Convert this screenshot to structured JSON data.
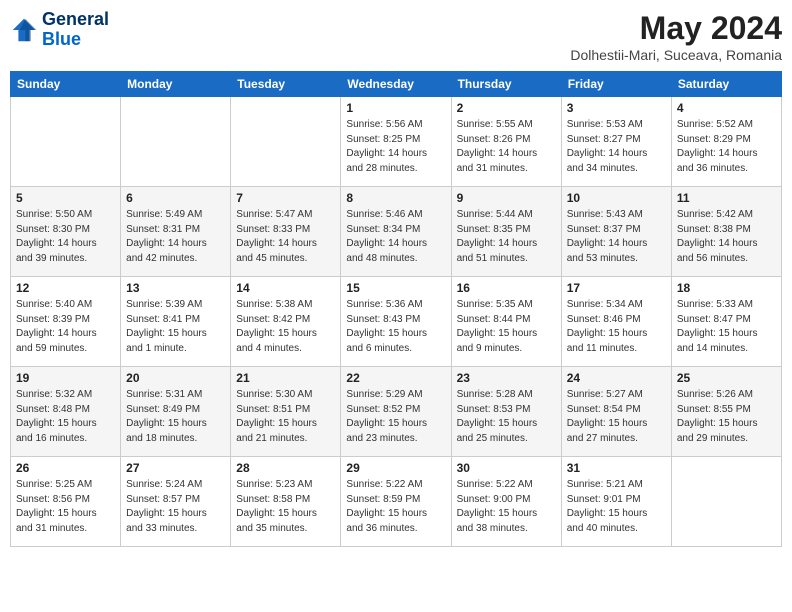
{
  "header": {
    "logo_line1": "General",
    "logo_line2": "Blue",
    "month": "May 2024",
    "location": "Dolhestii-Mari, Suceava, Romania"
  },
  "weekdays": [
    "Sunday",
    "Monday",
    "Tuesday",
    "Wednesday",
    "Thursday",
    "Friday",
    "Saturday"
  ],
  "weeks": [
    [
      {
        "day": "",
        "info": ""
      },
      {
        "day": "",
        "info": ""
      },
      {
        "day": "",
        "info": ""
      },
      {
        "day": "1",
        "info": "Sunrise: 5:56 AM\nSunset: 8:25 PM\nDaylight: 14 hours\nand 28 minutes."
      },
      {
        "day": "2",
        "info": "Sunrise: 5:55 AM\nSunset: 8:26 PM\nDaylight: 14 hours\nand 31 minutes."
      },
      {
        "day": "3",
        "info": "Sunrise: 5:53 AM\nSunset: 8:27 PM\nDaylight: 14 hours\nand 34 minutes."
      },
      {
        "day": "4",
        "info": "Sunrise: 5:52 AM\nSunset: 8:29 PM\nDaylight: 14 hours\nand 36 minutes."
      }
    ],
    [
      {
        "day": "5",
        "info": "Sunrise: 5:50 AM\nSunset: 8:30 PM\nDaylight: 14 hours\nand 39 minutes."
      },
      {
        "day": "6",
        "info": "Sunrise: 5:49 AM\nSunset: 8:31 PM\nDaylight: 14 hours\nand 42 minutes."
      },
      {
        "day": "7",
        "info": "Sunrise: 5:47 AM\nSunset: 8:33 PM\nDaylight: 14 hours\nand 45 minutes."
      },
      {
        "day": "8",
        "info": "Sunrise: 5:46 AM\nSunset: 8:34 PM\nDaylight: 14 hours\nand 48 minutes."
      },
      {
        "day": "9",
        "info": "Sunrise: 5:44 AM\nSunset: 8:35 PM\nDaylight: 14 hours\nand 51 minutes."
      },
      {
        "day": "10",
        "info": "Sunrise: 5:43 AM\nSunset: 8:37 PM\nDaylight: 14 hours\nand 53 minutes."
      },
      {
        "day": "11",
        "info": "Sunrise: 5:42 AM\nSunset: 8:38 PM\nDaylight: 14 hours\nand 56 minutes."
      }
    ],
    [
      {
        "day": "12",
        "info": "Sunrise: 5:40 AM\nSunset: 8:39 PM\nDaylight: 14 hours\nand 59 minutes."
      },
      {
        "day": "13",
        "info": "Sunrise: 5:39 AM\nSunset: 8:41 PM\nDaylight: 15 hours\nand 1 minute."
      },
      {
        "day": "14",
        "info": "Sunrise: 5:38 AM\nSunset: 8:42 PM\nDaylight: 15 hours\nand 4 minutes."
      },
      {
        "day": "15",
        "info": "Sunrise: 5:36 AM\nSunset: 8:43 PM\nDaylight: 15 hours\nand 6 minutes."
      },
      {
        "day": "16",
        "info": "Sunrise: 5:35 AM\nSunset: 8:44 PM\nDaylight: 15 hours\nand 9 minutes."
      },
      {
        "day": "17",
        "info": "Sunrise: 5:34 AM\nSunset: 8:46 PM\nDaylight: 15 hours\nand 11 minutes."
      },
      {
        "day": "18",
        "info": "Sunrise: 5:33 AM\nSunset: 8:47 PM\nDaylight: 15 hours\nand 14 minutes."
      }
    ],
    [
      {
        "day": "19",
        "info": "Sunrise: 5:32 AM\nSunset: 8:48 PM\nDaylight: 15 hours\nand 16 minutes."
      },
      {
        "day": "20",
        "info": "Sunrise: 5:31 AM\nSunset: 8:49 PM\nDaylight: 15 hours\nand 18 minutes."
      },
      {
        "day": "21",
        "info": "Sunrise: 5:30 AM\nSunset: 8:51 PM\nDaylight: 15 hours\nand 21 minutes."
      },
      {
        "day": "22",
        "info": "Sunrise: 5:29 AM\nSunset: 8:52 PM\nDaylight: 15 hours\nand 23 minutes."
      },
      {
        "day": "23",
        "info": "Sunrise: 5:28 AM\nSunset: 8:53 PM\nDaylight: 15 hours\nand 25 minutes."
      },
      {
        "day": "24",
        "info": "Sunrise: 5:27 AM\nSunset: 8:54 PM\nDaylight: 15 hours\nand 27 minutes."
      },
      {
        "day": "25",
        "info": "Sunrise: 5:26 AM\nSunset: 8:55 PM\nDaylight: 15 hours\nand 29 minutes."
      }
    ],
    [
      {
        "day": "26",
        "info": "Sunrise: 5:25 AM\nSunset: 8:56 PM\nDaylight: 15 hours\nand 31 minutes."
      },
      {
        "day": "27",
        "info": "Sunrise: 5:24 AM\nSunset: 8:57 PM\nDaylight: 15 hours\nand 33 minutes."
      },
      {
        "day": "28",
        "info": "Sunrise: 5:23 AM\nSunset: 8:58 PM\nDaylight: 15 hours\nand 35 minutes."
      },
      {
        "day": "29",
        "info": "Sunrise: 5:22 AM\nSunset: 8:59 PM\nDaylight: 15 hours\nand 36 minutes."
      },
      {
        "day": "30",
        "info": "Sunrise: 5:22 AM\nSunset: 9:00 PM\nDaylight: 15 hours\nand 38 minutes."
      },
      {
        "day": "31",
        "info": "Sunrise: 5:21 AM\nSunset: 9:01 PM\nDaylight: 15 hours\nand 40 minutes."
      },
      {
        "day": "",
        "info": ""
      }
    ]
  ]
}
